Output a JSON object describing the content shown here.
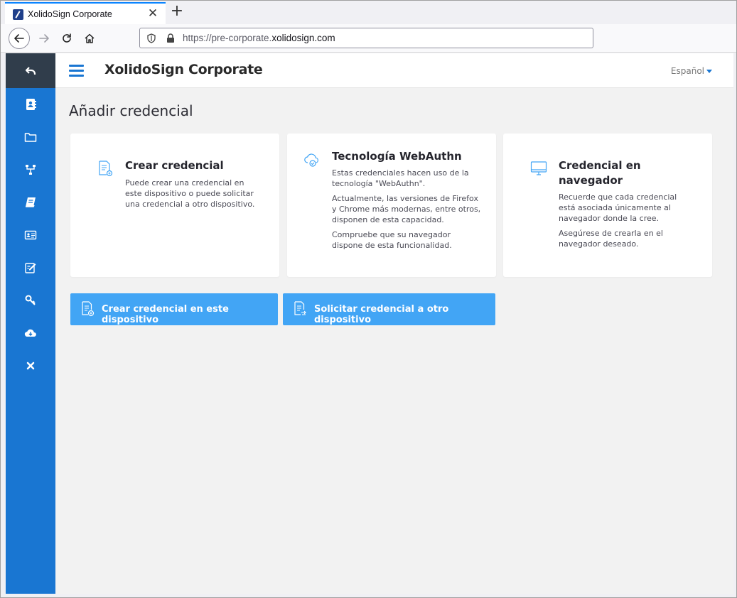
{
  "browser": {
    "tab_title": "XolidoSign Corporate",
    "tab_close": "✕",
    "new_tab": "+",
    "url_prefix": "https://pre-corporate.",
    "url_domain": "xolidosign.com"
  },
  "header": {
    "title": "XolidoSign Corporate",
    "language": "Español"
  },
  "sidebar": {
    "items": [
      {
        "icon": "back-arrow-icon"
      },
      {
        "icon": "contacts-book-icon"
      },
      {
        "icon": "folder-icon"
      },
      {
        "icon": "hierarchy-icon"
      },
      {
        "icon": "book-icon"
      },
      {
        "icon": "id-card-icon"
      },
      {
        "icon": "edit-icon"
      },
      {
        "icon": "key-icon"
      },
      {
        "icon": "cloud-download-icon"
      },
      {
        "icon": "close-icon"
      }
    ]
  },
  "page": {
    "title": "Añadir credencial"
  },
  "cards": [
    {
      "icon": "document-add-icon",
      "title": "Crear credencial",
      "paragraphs": [
        "Puede crear una credencial en este dispositivo o puede solicitar una credencial a otro dispositivo."
      ]
    },
    {
      "icon": "cloud-check-icon",
      "title": "Tecnología WebAuthn",
      "paragraphs": [
        "Estas credenciales hacen uso de la tecnología \"WebAuthn\".",
        "Actualmente, las versiones de Firefox y Chrome más modernas, entre otros, disponen de esta capacidad.",
        "Compruebe que su navegador dispone de esta funcionalidad."
      ]
    },
    {
      "icon": "monitor-icon",
      "title": "Credencial en navegador",
      "paragraphs": [
        "Recuerde que cada credencial está asociada únicamente al navegador donde la cree.",
        "Asegúrese de crearla en el navegador deseado."
      ]
    }
  ],
  "buttons": {
    "create_here": "Crear credencial en este dispositivo",
    "request_other": "Solicitar credencial a otro dispositivo"
  },
  "colors": {
    "sidebar": "#1976d2",
    "sidebar_top": "#303d4b",
    "button": "#42a5f5",
    "accent": "#1976d2"
  }
}
